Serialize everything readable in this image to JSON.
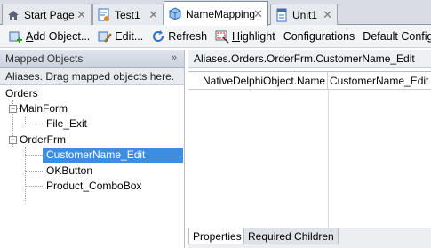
{
  "tabs": [
    {
      "label": "Start Page",
      "icon": "home-icon",
      "active": false
    },
    {
      "label": "Test1",
      "icon": "keyword-test-icon",
      "active": false
    },
    {
      "label": "NameMapping",
      "icon": "name-mapping-icon",
      "active": true
    },
    {
      "label": "Unit1",
      "icon": "script-unit-icon",
      "active": false
    }
  ],
  "tab_close_glyph": "✕",
  "toolbar": {
    "items": [
      {
        "label": "Add Object...",
        "underline": "A",
        "rest": "dd Object...",
        "icon": "add-object-icon"
      },
      {
        "label": "Edit...",
        "underline": "",
        "rest": "Edit...",
        "icon": "edit-icon"
      },
      {
        "label": "Refresh",
        "underline": "",
        "rest": "Refresh",
        "icon": "refresh-icon"
      },
      {
        "label": "Highlight",
        "underline": "H",
        "rest": "ighlight",
        "icon": "highlight-icon"
      },
      {
        "label": "Configurations",
        "underline": "",
        "rest": "Configurations",
        "icon": ""
      },
      {
        "label": "Default Configuration",
        "underline": "",
        "rest": "Default Configuration",
        "icon": ""
      }
    ]
  },
  "left_panel": {
    "title": "Mapped Objects",
    "collapse_glyph": "»",
    "subheader": "Aliases. Drag mapped objects here.",
    "tree": {
      "orders": "Orders",
      "mainform": "MainForm",
      "file_exit": "File_Exit",
      "orderfrm": "OrderFrm",
      "customername_edit": "CustomerName_Edit",
      "okbutton": "OKButton",
      "product_combobox": "Product_ComboBox"
    },
    "expander_glyph": "−",
    "selected": "CustomerName_Edit"
  },
  "right_panel": {
    "path": "Aliases.Orders.OrderFrm.CustomerName_Edit",
    "property_name": "NativeDelphiObject.Name",
    "property_value": "CustomerName_Edit",
    "bottom_tabs": [
      "Properties",
      "Required Children"
    ],
    "active_bottom_tab": "Properties"
  },
  "colors": {
    "selection": "#3d8ee0",
    "panel_header": "#ccd3de",
    "tab_strip": "#d9dde3"
  }
}
